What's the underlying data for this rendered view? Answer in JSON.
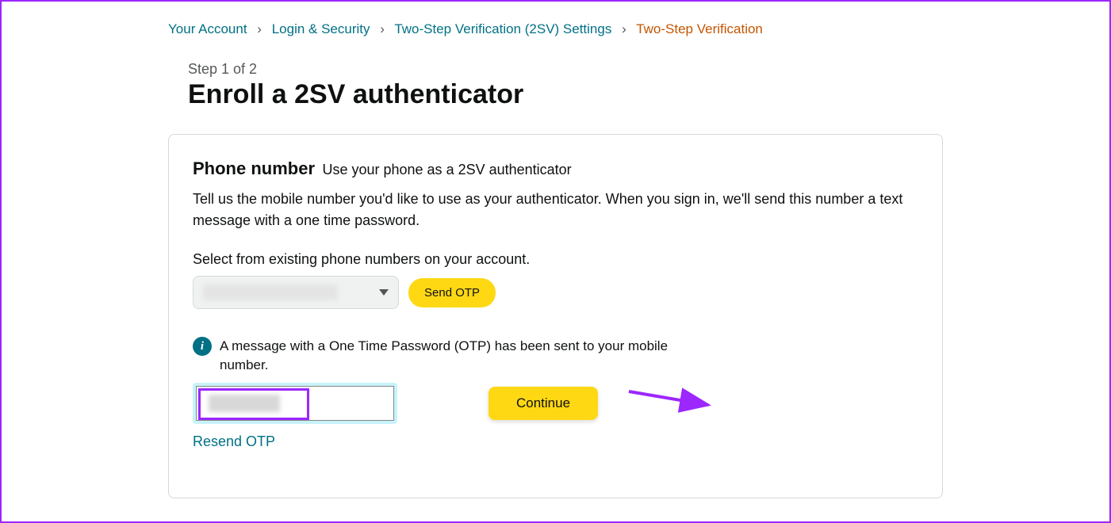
{
  "breadcrumb": {
    "items": [
      {
        "label": "Your Account"
      },
      {
        "label": "Login & Security"
      },
      {
        "label": "Two-Step Verification (2SV) Settings"
      }
    ],
    "current": "Two-Step Verification"
  },
  "step_label": "Step 1 of 2",
  "page_title": "Enroll a 2SV authenticator",
  "phone_section": {
    "title": "Phone number",
    "subtitle": "Use your phone as a 2SV authenticator",
    "body": "Tell us the mobile number you'd like to use as your authenticator. When you sign in, we'll send this number a text message with a one time password.",
    "select_label": "Select from existing phone numbers on your account.",
    "send_otp_label": "Send OTP"
  },
  "info_message": "A message with a One Time Password (OTP) has been sent to your mobile number.",
  "continue_label": "Continue",
  "resend_label": "Resend OTP"
}
